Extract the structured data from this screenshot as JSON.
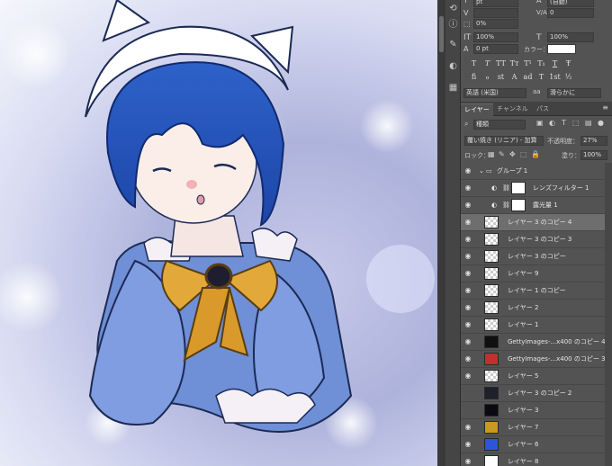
{
  "character_panel": {
    "size_value": "pt",
    "leading_value": "(自動)",
    "kerning_label": "V/A",
    "kerning_value": "0",
    "tracking_value": "0%",
    "vscale_value": "100%",
    "hscale_value": "100%",
    "baseline_value": "0 pt",
    "color_label": "カラー：",
    "color_swatch": "#ffffff",
    "style_buttons": [
      "T",
      "T",
      "TT",
      "Tт",
      "T¹",
      "T₁",
      "T",
      "Ŧ"
    ],
    "opentype_buttons": [
      "fi",
      "ℴ",
      "st",
      "A",
      "ad",
      "T",
      "1st",
      "½"
    ],
    "language_value": "英語 (米国)",
    "aa_label": "aa",
    "aa_value": "滑らかに"
  },
  "layers_panel": {
    "tabs": [
      "レイヤー",
      "チャンネル",
      "パス"
    ],
    "active_tab": 0,
    "filter_value": "種類",
    "blend_mode": "覆い焼き (リニア) - 加算",
    "opacity_label": "不透明度：",
    "opacity_value": "27%",
    "lock_label": "ロック：",
    "fill_label": "塗り：",
    "fill_value": "100%",
    "layers": [
      {
        "name": "グループ 1",
        "visible": true,
        "type": "group",
        "selected": false
      },
      {
        "name": "レンズフィルター 1",
        "visible": true,
        "type": "adjustment",
        "selected": false
      },
      {
        "name": "露光量 1",
        "visible": true,
        "type": "adjustment",
        "selected": false
      },
      {
        "name": "レイヤー 3 のコピー 4",
        "visible": true,
        "type": "layer",
        "selected": true
      },
      {
        "name": "レイヤー 3 のコピー 3",
        "visible": true,
        "type": "layer",
        "selected": false
      },
      {
        "name": "レイヤー 3 のコピー",
        "visible": true,
        "type": "layer",
        "selected": false
      },
      {
        "name": "レイヤー 9",
        "visible": true,
        "type": "layer",
        "selected": false
      },
      {
        "name": "レイヤー 1 のコピー",
        "visible": true,
        "type": "layer",
        "selected": false
      },
      {
        "name": "レイヤー 2",
        "visible": true,
        "type": "layer",
        "selected": false
      },
      {
        "name": "レイヤー 1",
        "visible": true,
        "type": "layer",
        "selected": false
      },
      {
        "name": "GettyImages-...x400 のコピー 4",
        "visible": true,
        "type": "layer",
        "selected": false
      },
      {
        "name": "GettyImages-...x400 のコピー 3",
        "visible": true,
        "type": "layer",
        "selected": false
      },
      {
        "name": "レイヤー 5",
        "visible": true,
        "type": "layer",
        "selected": false
      },
      {
        "name": "レイヤー 3 のコピー 2",
        "visible": false,
        "type": "layer",
        "selected": false
      },
      {
        "name": "レイヤー 3",
        "visible": false,
        "type": "layer",
        "selected": false
      },
      {
        "name": "レイヤー 7",
        "visible": true,
        "type": "layer",
        "selected": false
      },
      {
        "name": "レイヤー 6",
        "visible": true,
        "type": "layer",
        "selected": false
      },
      {
        "name": "レイヤー 8",
        "visible": true,
        "type": "layer",
        "selected": false
      }
    ]
  }
}
